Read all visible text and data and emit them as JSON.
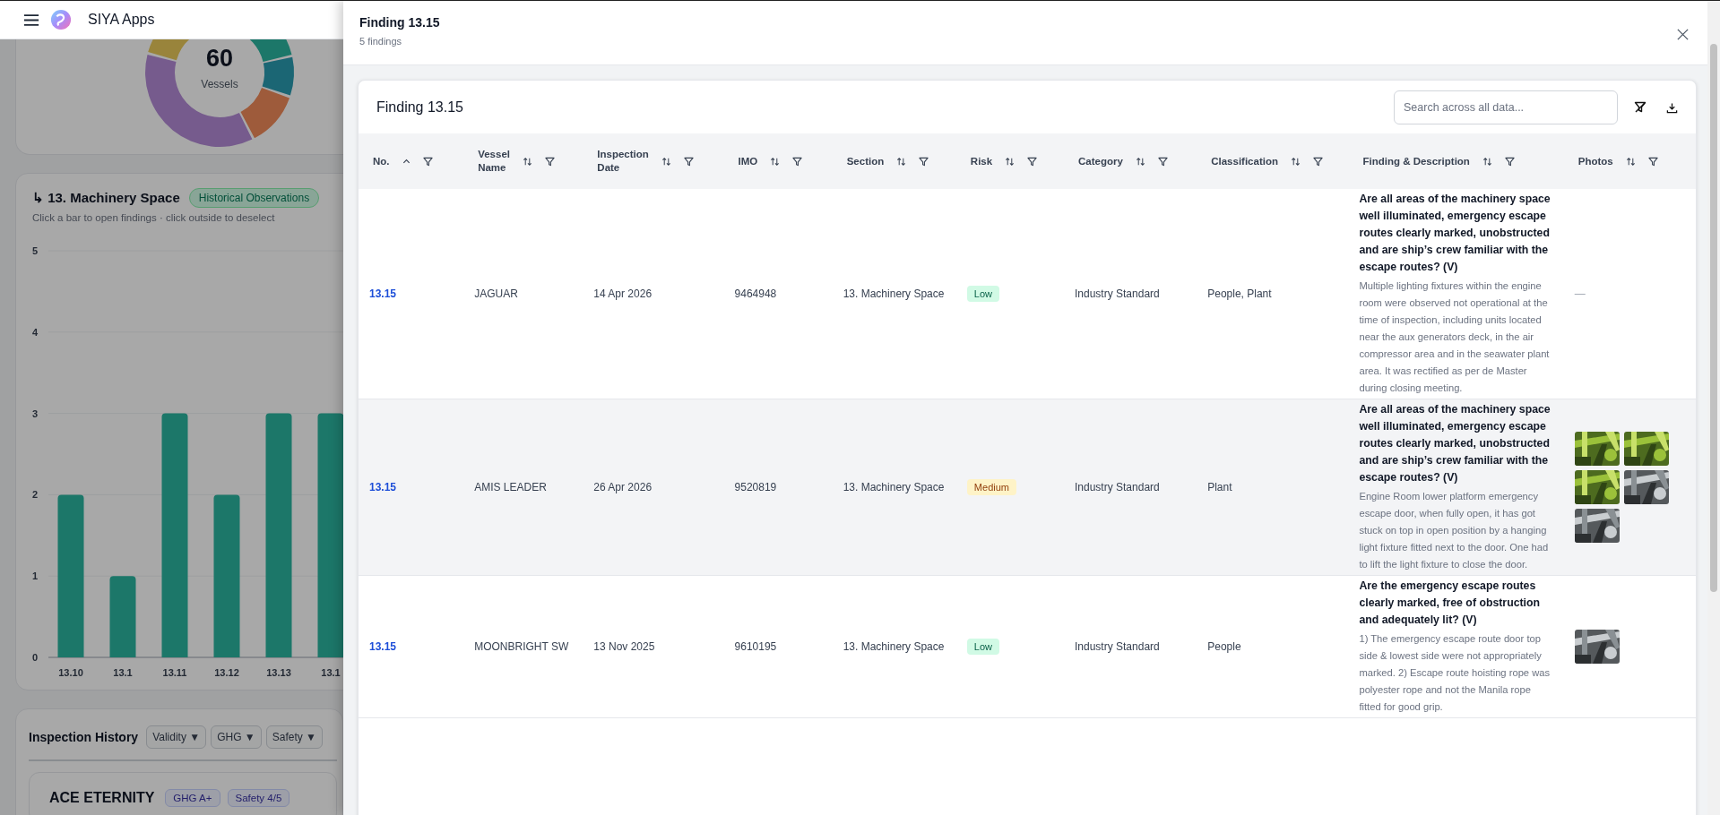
{
  "app_bar": {
    "title": "SIYA Apps"
  },
  "background": {
    "donut": {
      "total": "60",
      "caption": "Vessels"
    },
    "section_chart": {
      "title": "↳ 13. Machinery Space",
      "badge": "Historical Observations",
      "hint": "Click a bar to open findings · click outside to deselect",
      "chart_data": {
        "type": "bar",
        "categories": [
          "13.10",
          "13.1",
          "13.11",
          "13.12",
          "13.13",
          "13.1"
        ],
        "values": [
          2,
          1,
          3,
          2,
          3,
          3
        ],
        "grid": true,
        "ylim": [
          0,
          5
        ],
        "yticks": [
          0,
          1,
          2,
          3,
          4,
          5
        ]
      }
    },
    "inspection_history": {
      "title": "Inspection History",
      "filters": [
        "Validity ▼",
        "GHG ▼",
        "Safety ▼"
      ],
      "vessel": {
        "name": "ACE ETERNITY",
        "badges": [
          "GHG A+",
          "Safety 4/5"
        ]
      }
    }
  },
  "drawer": {
    "title": "Finding 13.15",
    "subtitle": "5 findings",
    "table_title": "Finding 13.15",
    "search": {
      "placeholder": "Search across all data..."
    },
    "columns": [
      {
        "label": "No.",
        "sorted": true
      },
      {
        "label": "Vessel Name",
        "sorted": false
      },
      {
        "label": "Inspection Date",
        "sorted": false
      },
      {
        "label": "IMO",
        "sorted": false
      },
      {
        "label": "Section",
        "sorted": false
      },
      {
        "label": "Risk",
        "sorted": false
      },
      {
        "label": "Category",
        "sorted": false
      },
      {
        "label": "Classification",
        "sorted": false
      },
      {
        "label": "Finding & Description",
        "sorted": false
      },
      {
        "label": "Photos",
        "sorted": false
      }
    ],
    "rows": [
      {
        "no": "13.15",
        "vessel": "JAGUAR",
        "date": "14 Apr 2026",
        "imo": "9464948",
        "section": "13. Machinery Space",
        "risk": "Low",
        "color": "#d1fae5",
        "category": "Industry Standard",
        "classification": "People, Plant",
        "question": "Are all areas of the machinery space well illuminated, emergency escape routes clearly marked, unobstructed and are ship’s crew familiar with the escape routes? (V)",
        "description": "Multiple lighting fixtures within the engine room were observed not operational at the time of inspection, including units located near the aux generators deck, in the air compressor area and in the seawater plant area. It was rectified as per de Master during closing meeting.",
        "photos_text": "—",
        "highlighted": false
      },
      {
        "no": "13.15",
        "vessel": "AMIS LEADER",
        "date": "26 Apr 2026",
        "imo": "9520819",
        "section": "13. Machinery Space",
        "risk": "Medium",
        "color": "#fef3c7",
        "category": "Industry Standard",
        "classification": "Plant",
        "question": "Are all areas of the machinery space well illuminated, emergency escape routes clearly marked, unobstructed and are ship’s crew familiar with the escape routes? (V)",
        "description": "Engine Room lower platform emergency escape door, when fully open, it has got stuck on top in open position by a hanging light fixture fitted next to the door. One had to lift the light fixture to close the door.",
        "highlighted": true
      },
      {
        "no": "13.15",
        "vessel": "MOONBRIGHT SW",
        "date": "13 Nov 2025",
        "imo": "9610195",
        "section": "13. Machinery Space",
        "risk": "Low",
        "color": "#d1fae5",
        "category": "Industry Standard",
        "classification": "People",
        "question": "Are the emergency escape routes clearly marked, free of obstruction and adequately lit? (V)",
        "description": "1) The emergency escape route door top side & lowest side were not appropriately marked. 2) Escape route hoisting rope was polyester rope and not the Manila rope fitted for good grip.",
        "highlighted": false
      }
    ]
  }
}
